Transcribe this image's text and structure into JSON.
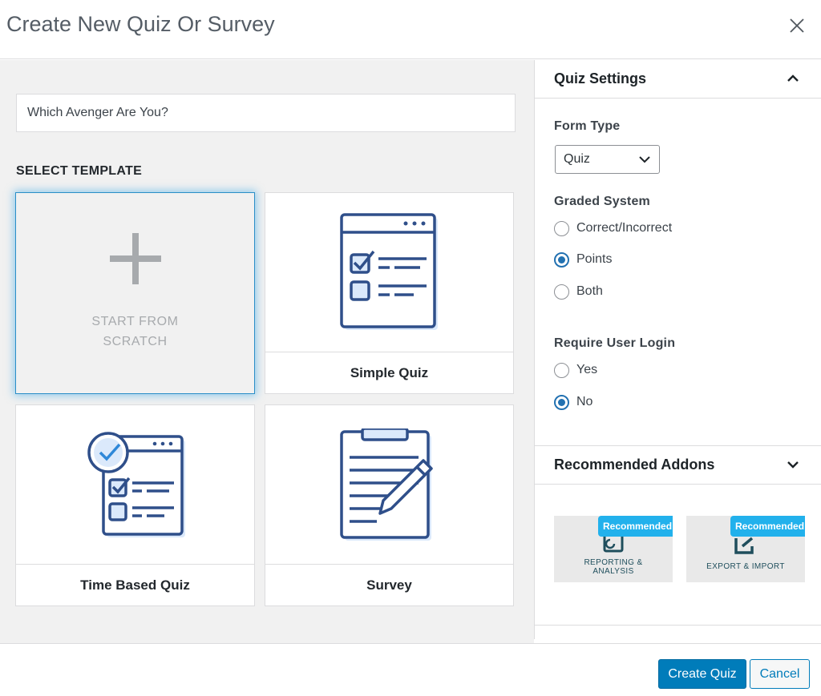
{
  "dialog": {
    "title": "Create New Quiz Or Survey",
    "close_icon": "close-icon"
  },
  "quiz_title_input": {
    "value": "Which Avenger Are You?"
  },
  "templates": {
    "heading": "SELECT TEMPLATE",
    "scratch": {
      "line1": "START FROM",
      "line2": "SCRATCH",
      "icon": "plus-icon"
    },
    "items": [
      {
        "label": "Simple Quiz",
        "icon": "quiz-checklist-icon"
      },
      {
        "label": "Time Based Quiz",
        "icon": "timed-quiz-icon"
      },
      {
        "label": "Survey",
        "icon": "survey-clipboard-icon"
      }
    ]
  },
  "settings": {
    "title": "Quiz Settings",
    "form_type": {
      "label": "Form Type",
      "selected": "Quiz"
    },
    "graded_system": {
      "label": "Graded System",
      "options": [
        "Correct/Incorrect",
        "Points",
        "Both"
      ],
      "selected": "Points"
    },
    "require_login": {
      "label": "Require User Login",
      "options": [
        "Yes",
        "No"
      ],
      "selected": "No"
    }
  },
  "addons": {
    "title": "Recommended Addons",
    "items": [
      {
        "badge": "Recommended",
        "name_line1": "REPORTING &",
        "name_line2": "ANALYSIS",
        "icon": "reporting-icon"
      },
      {
        "badge": "Recommended",
        "name_line1": "EXPORT & IMPORT",
        "name_line2": "",
        "icon": "export-icon"
      }
    ]
  },
  "footer": {
    "primary": "Create Quiz",
    "secondary": "Cancel"
  },
  "colors": {
    "accent": "#007cba",
    "badge": "#22b1ec",
    "icon_stroke": "#2f4f8a",
    "icon_fill": "#dbe9fb"
  }
}
